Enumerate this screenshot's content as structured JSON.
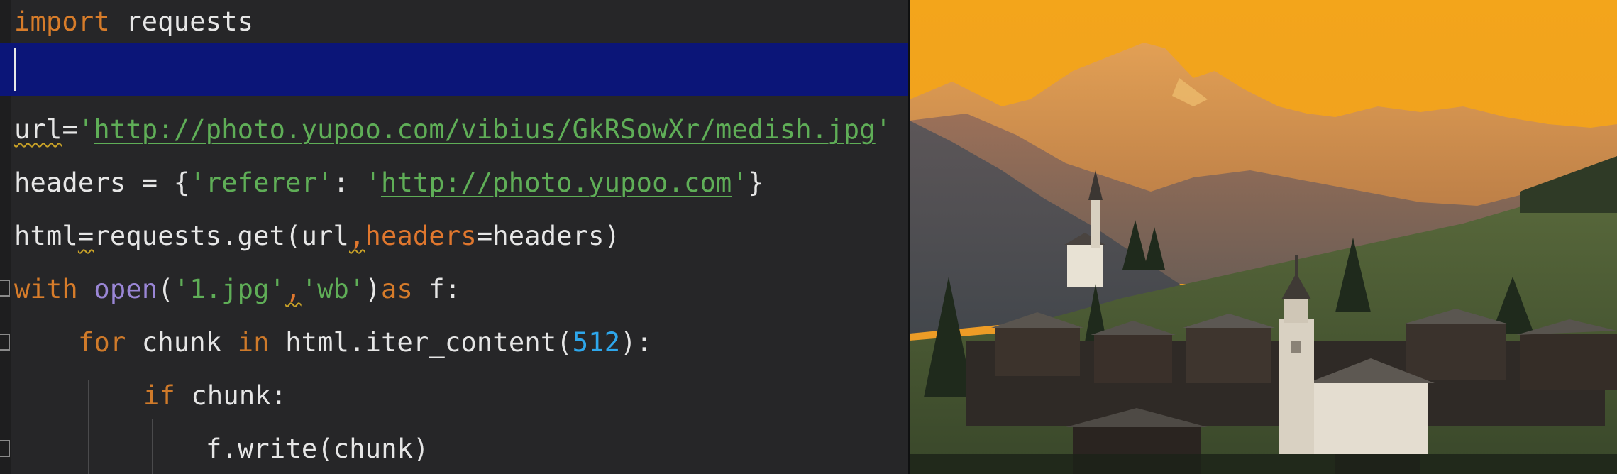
{
  "editor": {
    "lines": {
      "l1": {
        "kw": "import",
        "rest": " requests"
      },
      "l3": {
        "var": "url",
        "eq": "=",
        "q1": "'",
        "url": "http://photo.yupoo.com/vibius/GkRSowXr/medish.jpg",
        "q2": "'"
      },
      "l4": {
        "head": "headers = {",
        "k": "'referer'",
        "colon": ": ",
        "q1": "'",
        "url": "http://photo.yupoo.com",
        "q2": "'",
        "tail": "}"
      },
      "l5": {
        "a": "html",
        "b": "=",
        "c": "requests.get(url",
        "comma": ",",
        "param": "headers",
        "d": "=headers)"
      },
      "l6": {
        "kw": "with",
        "sp": " ",
        "fn": "open",
        "p": "(",
        "s1": "'1.jpg'",
        "c1": ",",
        "s2": "'wb'",
        "p2": ")",
        "as": "as",
        "f": " f:"
      },
      "l7": {
        "kw": "for",
        "a": " chunk ",
        "in": "in",
        "b": " html.iter_content(",
        "num": "512",
        "c": "):"
      },
      "l8": {
        "kw": "if",
        "a": " chunk:"
      },
      "l9": {
        "a": "f.write(chunk)"
      }
    }
  },
  "photo": {
    "subject": "Alpine village with church at sunset",
    "colors": {
      "sky": "#f2a319",
      "mountain_far": "#d08a3a",
      "mountain_mid": "#8a6a55",
      "hill": "#4b5a3a",
      "village": "#3a342e"
    }
  }
}
